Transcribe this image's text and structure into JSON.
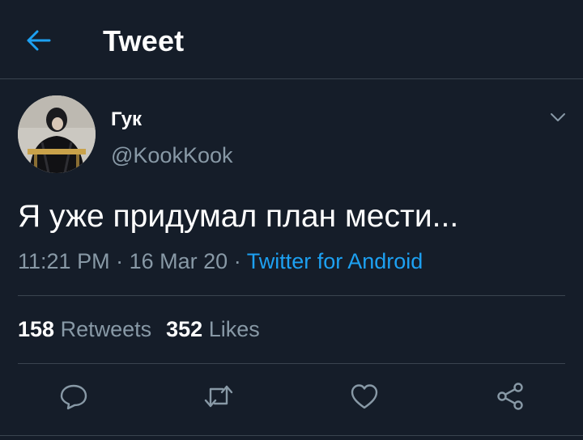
{
  "header": {
    "title": "Tweet",
    "back_icon": "arrow-left-icon"
  },
  "tweet": {
    "author": {
      "display_name": "Гук",
      "handle": "@KookKook"
    },
    "text": "Я уже придумал план мести...",
    "time": "11:21 PM",
    "separator": "·",
    "date": "16 Mar 20",
    "source": "Twitter for Android",
    "retweets_count": "158",
    "retweets_label": "Retweets",
    "likes_count": "352",
    "likes_label": "Likes"
  },
  "actions": [
    {
      "icon": "reply-icon"
    },
    {
      "icon": "retweet-icon"
    },
    {
      "icon": "like-icon"
    },
    {
      "icon": "share-icon"
    }
  ],
  "colors": {
    "background": "#151d29",
    "accent": "#1da1f2",
    "secondary_text": "#8899a6",
    "divider": "#3a444f"
  }
}
